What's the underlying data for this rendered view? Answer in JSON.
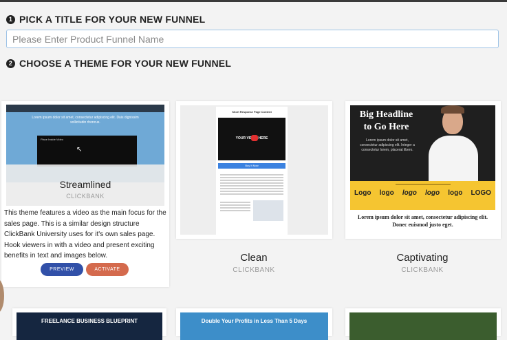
{
  "step1": {
    "number": "1",
    "title": "PICK A TITLE FOR YOUR NEW FUNNEL"
  },
  "funnel_name": {
    "placeholder": "Please Enter Product Funnel Name",
    "value": ""
  },
  "step2": {
    "number": "2",
    "title": "CHOOSE A THEME FOR YOUR NEW FUNNEL"
  },
  "themes": [
    {
      "name": "Streamlined",
      "vendor": "CLICKBANK",
      "description": "This theme features a video as the main focus for the sales page. This is a similar design structure ClickBank University uses for it's own sales page. Hook viewers in with a video and present exciting benefits in text and images below.",
      "preview_label": "PREVIEW",
      "activate_label": "ACTIVATE",
      "thumb_headline": "Lorem ipsum dolor sit amet, consectetur adipiscing elit. Duis dignissim sollicitudin rhoncus.",
      "thumb_video_title": "Place Inside Video"
    },
    {
      "name": "Clean",
      "vendor": "CLICKBANK",
      "thumb_headline": "Short Response Page Content",
      "thumb_video_text": "YOUR VIDEO HERE",
      "thumb_button": "Buy It Now"
    },
    {
      "name": "Captivating",
      "vendor": "CLICKBANK",
      "thumb_headline": "Big Headline to Go Here",
      "thumb_body": "Lorem ipsum dolor sit amet, consectetur adipiscing elit. Integer a consectetur lorem, placerat libero.",
      "thumb_logos": [
        "Logo",
        "logo",
        "logo",
        "logo",
        "logo",
        "LOGO"
      ],
      "thumb_footer": "Lorem ipsum dolor sit amet, consectetur adipiscing elit. Donec euismod justo eget."
    }
  ],
  "row2": [
    {
      "thumb_headline": "FREELANCE BUSINESS BLUEPRINT"
    },
    {
      "thumb_headline": "Double Your Profits in Less Than 5 Days"
    },
    {
      "thumb_headline": ""
    }
  ],
  "colors": {
    "preview": "#3150a8",
    "activate": "#d46a4d",
    "input_border": "#9ec3e6",
    "clean_button": "#3b82e0",
    "captivating_band": "#f5c531"
  }
}
